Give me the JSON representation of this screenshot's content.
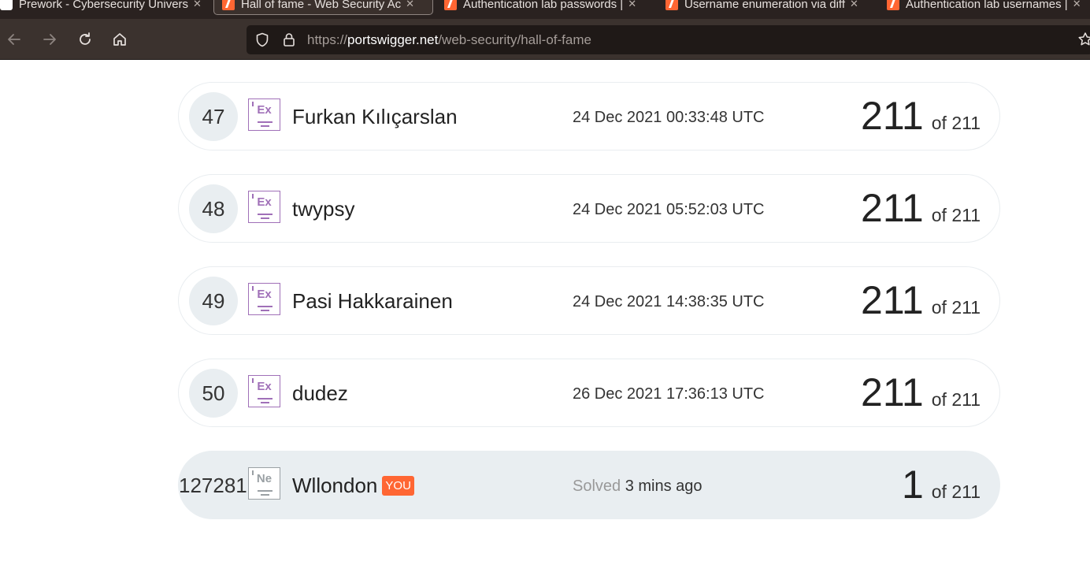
{
  "browser": {
    "tabs": [
      {
        "title": "Prework - Cybersecurity Univers",
        "favicon": "github-icon"
      },
      {
        "title": "Hall of fame - Web Security Ac",
        "favicon": "portswigger-icon",
        "active": true
      },
      {
        "title": "Authentication lab passwords |",
        "favicon": "portswigger-icon"
      },
      {
        "title": "Username enumeration via diff",
        "favicon": "portswigger-icon"
      },
      {
        "title": "Authentication lab usernames |",
        "favicon": "portswigger-icon"
      }
    ],
    "url_scheme": "https://",
    "url_host": "portswigger.net",
    "url_path": "/web-security/hall-of-fame",
    "icons": [
      "back-icon",
      "forward-icon",
      "reload-icon",
      "home-icon",
      "shield-icon",
      "lock-icon",
      "bookmark-star-icon"
    ]
  },
  "leaderboard": {
    "rows": [
      {
        "rank": "47",
        "badge": "Ex",
        "name": "Furkan Kılıçarslan",
        "date": "24 Dec 2021 00:33:48 UTC",
        "solved": "211",
        "of_total": "of 211"
      },
      {
        "rank": "48",
        "badge": "Ex",
        "name": "twypsy",
        "date": "24 Dec 2021 05:52:03 UTC",
        "solved": "211",
        "of_total": "of 211"
      },
      {
        "rank": "49",
        "badge": "Ex",
        "name": "Pasi Hakkarainen",
        "date": "24 Dec 2021 14:38:35 UTC",
        "solved": "211",
        "of_total": "of 211"
      },
      {
        "rank": "50",
        "badge": "Ex",
        "name": "dudez",
        "date": "26 Dec 2021 17:36:13 UTC",
        "solved": "211",
        "of_total": "of 211"
      }
    ],
    "me": {
      "rank": "127281",
      "badge": "Ne",
      "name": "Wllondon",
      "you_label": "YOU",
      "solved_prefix": "Solved",
      "solved_when": "3 mins ago",
      "solved": "1",
      "of_total": "of 211"
    }
  },
  "colors": {
    "accent": "#ff6633",
    "expert_badge": "#a070b8",
    "row_highlight": "#e9eef1"
  }
}
